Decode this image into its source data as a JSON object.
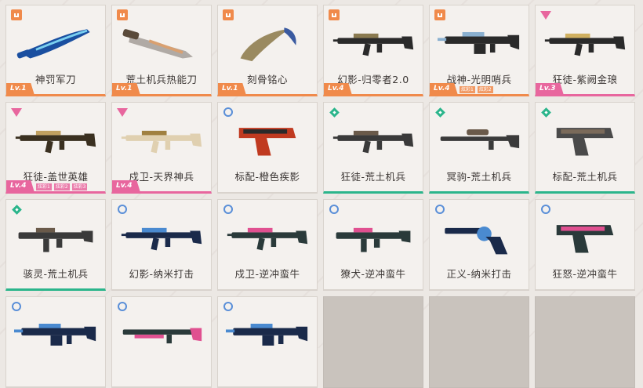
{
  "items": [
    {
      "name": "神罚军刀",
      "rarity": "orange",
      "level": "Lv.1",
      "tags": [],
      "icon": "knife-icon",
      "colors": [
        "#1a4fa0",
        "#7ad0f0"
      ]
    },
    {
      "name": "荒土机兵热能刀",
      "rarity": "orange",
      "level": "Lv.1",
      "tags": [],
      "icon": "machete-icon",
      "colors": [
        "#5a4a3a",
        "#d9a070"
      ]
    },
    {
      "name": "刻骨铭心",
      "rarity": "orange",
      "level": "Lv.1",
      "tags": [],
      "icon": "karambit-icon",
      "colors": [
        "#9a8a60",
        "#3a5aa0"
      ]
    },
    {
      "name": "幻影-归零者2.0",
      "rarity": "orange",
      "level": "Lv.4",
      "tags": [],
      "icon": "rifle-icon",
      "colors": [
        "#2a2a2a",
        "#8a7a50"
      ]
    },
    {
      "name": "战神-光明哨兵",
      "rarity": "orange",
      "level": "Lv.4",
      "tags": [
        "炫彩1",
        "炫彩2"
      ],
      "icon": "machine-gun-icon",
      "colors": [
        "#2a2a2a",
        "#8ab0d0"
      ]
    },
    {
      "name": "狂徒-紫阙金琅",
      "rarity": "pink",
      "level": "Lv.3",
      "tags": [],
      "icon": "rifle-icon",
      "colors": [
        "#2a2a2a",
        "#d0b060"
      ]
    },
    {
      "name": "狂徒-盖世英雄",
      "rarity": "pink",
      "level": "Lv.4",
      "tags": [
        "炫彩1",
        "炫彩2",
        "炫彩3"
      ],
      "icon": "rifle-icon",
      "colors": [
        "#3a3020",
        "#c0a060"
      ]
    },
    {
      "name": "戍卫-天界神兵",
      "rarity": "pink",
      "level": "Lv.4",
      "tags": [],
      "icon": "rifle-icon",
      "colors": [
        "#e0d0b0",
        "#a08040"
      ]
    },
    {
      "name": "标配-橙色疾影",
      "rarity": "blue",
      "level": "",
      "tags": [],
      "icon": "pistol-icon",
      "colors": [
        "#c03a20",
        "#2a2a2a"
      ]
    },
    {
      "name": "狂徒-荒土机兵",
      "rarity": "green",
      "level": "",
      "tags": [],
      "icon": "rifle-icon",
      "colors": [
        "#3a3a3a",
        "#6a5a4a"
      ]
    },
    {
      "name": "冥驹-荒土机兵",
      "rarity": "green",
      "level": "",
      "tags": [],
      "icon": "sniper-icon",
      "colors": [
        "#3a3a3a",
        "#6a5a4a"
      ]
    },
    {
      "name": "标配-荒土机兵",
      "rarity": "green",
      "level": "",
      "tags": [],
      "icon": "pistol-icon",
      "colors": [
        "#4a4a4a",
        "#7a6a5a"
      ]
    },
    {
      "name": "骇灵-荒土机兵",
      "rarity": "green",
      "level": "",
      "tags": [],
      "icon": "smg-icon",
      "colors": [
        "#3a3a3a",
        "#6a5a4a"
      ]
    },
    {
      "name": "幻影-纳米打击",
      "rarity": "blue",
      "level": "",
      "tags": [],
      "icon": "rifle-icon",
      "colors": [
        "#1a2a4a",
        "#4a8ad0"
      ]
    },
    {
      "name": "戍卫-逆冲蛮牛",
      "rarity": "blue",
      "level": "",
      "tags": [],
      "icon": "rifle-icon",
      "colors": [
        "#2a3a3a",
        "#e05090"
      ]
    },
    {
      "name": "獠犬-逆冲蛮牛",
      "rarity": "blue",
      "level": "",
      "tags": [],
      "icon": "smg-icon",
      "colors": [
        "#2a3a3a",
        "#e05090"
      ]
    },
    {
      "name": "正义-纳米打击",
      "rarity": "blue",
      "level": "",
      "tags": [],
      "icon": "revolver-icon",
      "colors": [
        "#1a2a4a",
        "#4a8ad0"
      ]
    },
    {
      "name": "狂怒-逆冲蛮牛",
      "rarity": "blue",
      "level": "",
      "tags": [],
      "icon": "pistol-icon",
      "colors": [
        "#2a3a3a",
        "#e05090"
      ]
    },
    {
      "name": "",
      "rarity": "blue",
      "level": "",
      "tags": [],
      "icon": "machine-gun-icon",
      "colors": [
        "#1a2a4a",
        "#4a8ad0"
      ]
    },
    {
      "name": "",
      "rarity": "blue",
      "level": "",
      "tags": [],
      "icon": "shotgun-icon",
      "colors": [
        "#2a3a3a",
        "#e05090"
      ]
    },
    {
      "name": "",
      "rarity": "blue",
      "level": "",
      "tags": [],
      "icon": "machine-gun-icon",
      "colors": [
        "#1a2a4a",
        "#4a8ad0"
      ]
    },
    {
      "empty": true
    },
    {
      "empty": true
    },
    {
      "empty": true
    }
  ],
  "rarity_colors": {
    "orange": "#f08a4b",
    "pink": "#e8669e",
    "green": "#2bb58b",
    "blue": "#5a8fd8"
  }
}
